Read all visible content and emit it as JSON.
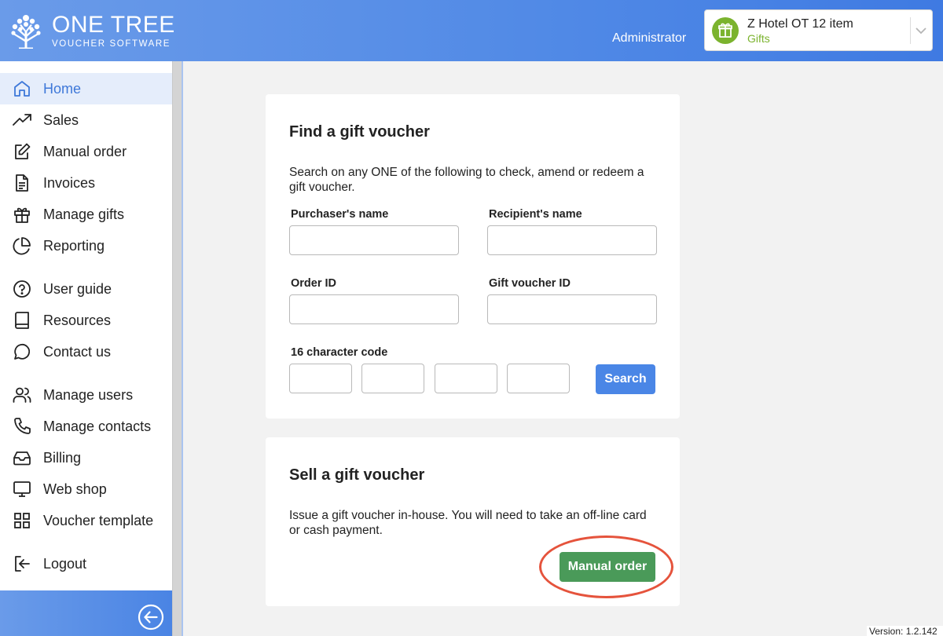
{
  "header": {
    "logo_main": "ONE TREE",
    "logo_sub": "VOUCHER SOFTWARE",
    "user_role": "Administrator",
    "hotel": {
      "name": "Z Hotel OT 12 item",
      "subtitle": "Gifts",
      "badge_icon": "gift-icon",
      "badge_color": "#7bb32e"
    }
  },
  "sidebar": {
    "items": [
      {
        "label": "Home",
        "icon": "home-icon",
        "active": true
      },
      {
        "label": "Sales",
        "icon": "trending-up-icon"
      },
      {
        "label": "Manual order",
        "icon": "edit-icon"
      },
      {
        "label": "Invoices",
        "icon": "document-icon"
      },
      {
        "label": "Manage gifts",
        "icon": "gift-icon"
      },
      {
        "label": "Reporting",
        "icon": "pie-chart-icon"
      },
      {
        "label": "User guide",
        "icon": "help-circle-icon"
      },
      {
        "label": "Resources",
        "icon": "book-icon"
      },
      {
        "label": "Contact us",
        "icon": "message-circle-icon"
      },
      {
        "label": "Manage users",
        "icon": "users-icon"
      },
      {
        "label": "Manage contacts",
        "icon": "phone-icon"
      },
      {
        "label": "Billing",
        "icon": "inbox-icon"
      },
      {
        "label": "Web shop",
        "icon": "monitor-icon"
      },
      {
        "label": "Voucher template",
        "icon": "grid-icon"
      },
      {
        "label": "Logout",
        "icon": "logout-icon"
      }
    ],
    "collapse_icon": "arrow-left-circle-icon"
  },
  "find_card": {
    "title": "Find a gift voucher",
    "description": "Search on any ONE of the following to check, amend or redeem a gift voucher.",
    "purchaser_label": "Purchaser's name",
    "purchaser_value": "",
    "recipient_label": "Recipient's name",
    "recipient_value": "",
    "order_label": "Order ID",
    "order_value": "",
    "voucher_id_label": "Gift voucher ID",
    "voucher_id_value": "",
    "code_label": "16 character code",
    "code_values": [
      "",
      "",
      "",
      ""
    ],
    "search_button": "Search"
  },
  "sell_card": {
    "title": "Sell a gift voucher",
    "description": "Issue a gift voucher in-house. You will need to take an off-line card or cash payment.",
    "manual_order_button": "Manual order"
  },
  "footer": {
    "version": "Version: 1.2.142"
  },
  "colors": {
    "accent": "#4a86e6",
    "active_nav_text": "#3e78d9",
    "active_nav_bg": "#e5edfb",
    "success_button": "#4a9a59",
    "highlight_circle": "#e5533c"
  }
}
